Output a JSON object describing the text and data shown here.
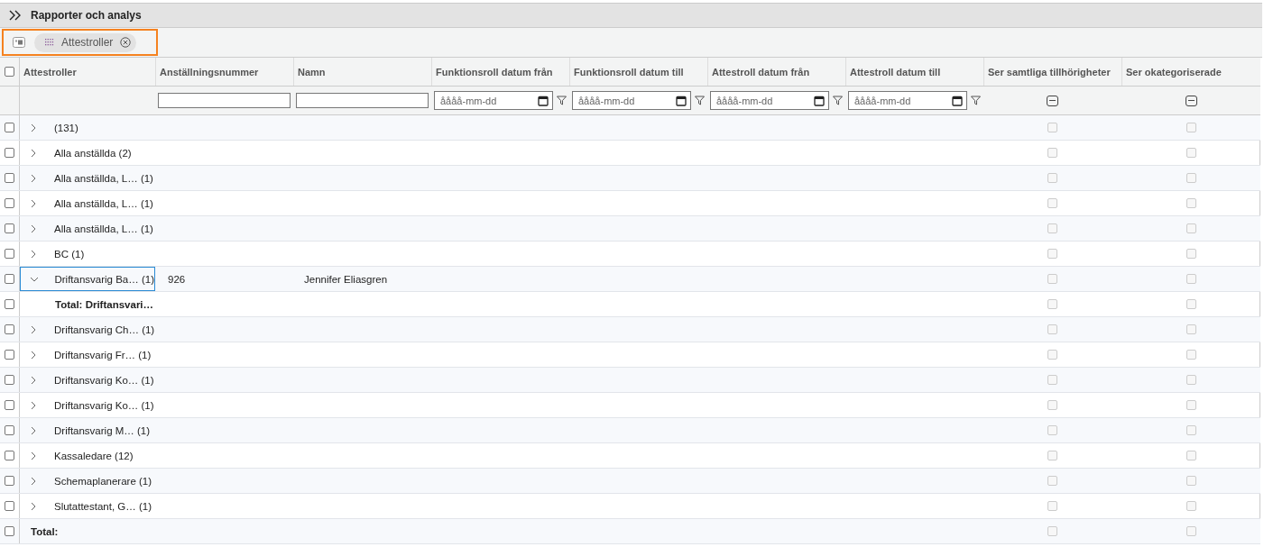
{
  "header": {
    "title": "Rapporter och analys"
  },
  "group_panel": {
    "highlighted": true,
    "chips": [
      {
        "label": "Attestroller"
      }
    ]
  },
  "table": {
    "select_all": {
      "checked": false
    },
    "columns": [
      {
        "label": "Attestroller",
        "filter": {
          "kind": "none"
        }
      },
      {
        "label": "Anställningsnummer",
        "filter": {
          "kind": "text"
        }
      },
      {
        "label": "Namn",
        "filter": {
          "kind": "text"
        }
      },
      {
        "label": "Funktionsroll datum från",
        "filter": {
          "kind": "date",
          "placeholder": "åååå-mm-dd"
        }
      },
      {
        "label": "Funktionsroll datum till",
        "filter": {
          "kind": "date",
          "placeholder": "åååå-mm-dd"
        }
      },
      {
        "label": "Attestroll datum från",
        "filter": {
          "kind": "date",
          "placeholder": "åååå-mm-dd"
        }
      },
      {
        "label": "Attestroll datum till",
        "filter": {
          "kind": "date",
          "placeholder": "åååå-mm-dd"
        }
      },
      {
        "label": "Ser samtliga tillhörigheter",
        "filter": {
          "kind": "tristate",
          "indeterminate": true
        }
      },
      {
        "label": "Ser okategoriserade",
        "filter": {
          "kind": "tristate",
          "indeterminate": true
        }
      }
    ],
    "rows": [
      {
        "kind": "group",
        "label": " (131)",
        "expanded": false,
        "selected": false,
        "checked": false,
        "flags_disabled": true
      },
      {
        "kind": "group",
        "label": "Alla anställda (2)",
        "expanded": false,
        "selected": false,
        "checked": false,
        "flags_disabled": true
      },
      {
        "kind": "group",
        "label": "Alla anställda, L…  (1)",
        "expanded": false,
        "selected": false,
        "checked": false,
        "flags_disabled": true
      },
      {
        "kind": "group",
        "label": "Alla anställda, L…  (1)",
        "expanded": false,
        "selected": false,
        "checked": false,
        "flags_disabled": true
      },
      {
        "kind": "group",
        "label": "Alla anställda, L…  (1)",
        "expanded": false,
        "selected": false,
        "checked": false,
        "flags_disabled": true
      },
      {
        "kind": "group",
        "label": "BC (1)",
        "expanded": false,
        "selected": false,
        "checked": false,
        "flags_disabled": true
      },
      {
        "kind": "group",
        "label": "Driftansvarig Ba…  (1)",
        "expanded": true,
        "selected": true,
        "checked": false,
        "flags_disabled": true,
        "employee_number": "926",
        "name": "Jennifer Eliasgren"
      },
      {
        "kind": "total",
        "label": "Total: Driftansvari…",
        "checked": false,
        "flags_disabled": true
      },
      {
        "kind": "group",
        "label": "Driftansvarig Ch…  (1)",
        "expanded": false,
        "selected": false,
        "checked": false,
        "flags_disabled": true
      },
      {
        "kind": "group",
        "label": "Driftansvarig Fr…  (1)",
        "expanded": false,
        "selected": false,
        "checked": false,
        "flags_disabled": true
      },
      {
        "kind": "group",
        "label": "Driftansvarig Ko…  (1)",
        "expanded": false,
        "selected": false,
        "checked": false,
        "flags_disabled": true
      },
      {
        "kind": "group",
        "label": "Driftansvarig Ko…  (1)",
        "expanded": false,
        "selected": false,
        "checked": false,
        "flags_disabled": true
      },
      {
        "kind": "group",
        "label": "Driftansvarig M…  (1)",
        "expanded": false,
        "selected": false,
        "checked": false,
        "flags_disabled": true
      },
      {
        "kind": "group",
        "label": "Kassaledare (12)",
        "expanded": false,
        "selected": false,
        "checked": false,
        "flags_disabled": true
      },
      {
        "kind": "group",
        "label": "Schemaplanerare (1)",
        "expanded": false,
        "selected": false,
        "checked": false,
        "flags_disabled": true
      },
      {
        "kind": "group",
        "label": "Slutattestant, G…  (1)",
        "expanded": false,
        "selected": false,
        "checked": false,
        "flags_disabled": true
      },
      {
        "kind": "total",
        "label": "Total:",
        "checked": false,
        "flags_disabled": true
      }
    ]
  }
}
